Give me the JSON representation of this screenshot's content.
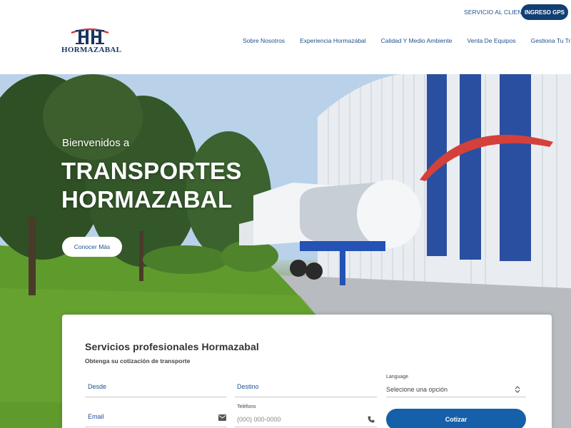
{
  "header": {
    "service_link": "SERVICIO AL CLIENTE",
    "gps_button": "INGRESO GPS",
    "logo_text": "HORMAZABAL",
    "nav": [
      "Sobre Nosotros",
      "Experiencia Hormazábal",
      "Calidad Y Medio Ambiente",
      "Venta De Equipos",
      "Gestiona Tu Transporte"
    ]
  },
  "hero": {
    "welcome": "Bienvenidos a",
    "title_line1": "TRANSPORTES",
    "title_line2": "HORMAZABAL",
    "cta": "Conocer Más"
  },
  "quote_form": {
    "title": "Servicios profesionales Hormazabal",
    "subtitle": "Obtenga su cotización de transporte",
    "desde_label": "Desde",
    "destino_label": "Destino",
    "language_label": "Language",
    "language_value": "Selecione una opción",
    "email_label": "Email",
    "telefono_label": "Teléfono",
    "telefono_placeholder": "(000) 000-0000",
    "submit": "Cotizar"
  },
  "icons": {
    "email": "envelope-icon",
    "phone": "phone-icon",
    "select": "select-arrows-icon"
  },
  "colors": {
    "brand_blue": "#123f73",
    "link_blue": "#1f4f8f",
    "button_blue": "#1560a8",
    "logo_red": "#d03a3a"
  }
}
